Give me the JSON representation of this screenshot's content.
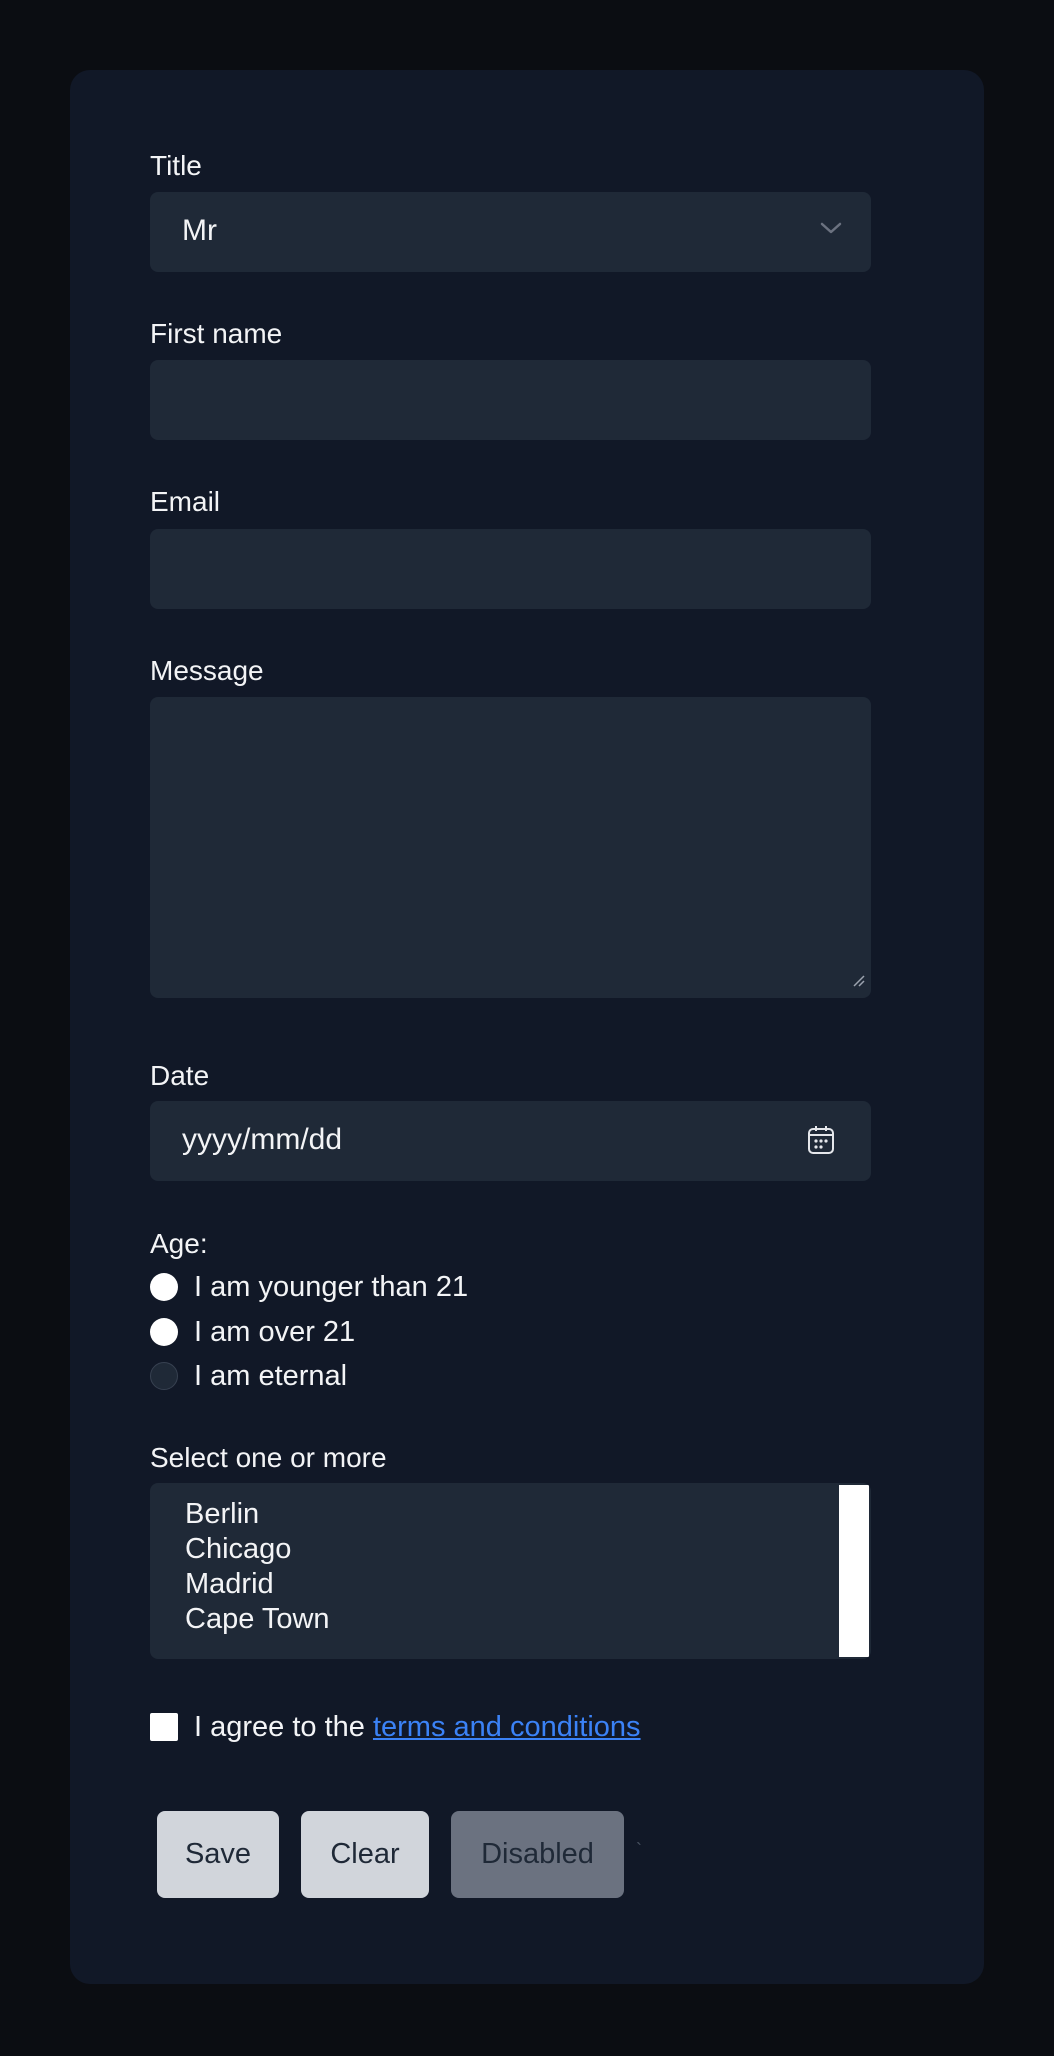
{
  "form": {
    "title_label": "Title",
    "title_value": "Mr",
    "first_name_label": "First name",
    "first_name_value": "",
    "email_label": "Email",
    "email_value": "",
    "message_label": "Message",
    "message_value": "",
    "date_label": "Date",
    "date_placeholder": "yyyy/mm/dd",
    "age_label": "Age:",
    "age_options": [
      {
        "label": "I am younger than 21",
        "checked": false
      },
      {
        "label": "I am over 21",
        "checked": false
      },
      {
        "label": "I am eternal",
        "checked": false,
        "disabled": true
      }
    ],
    "city_label": "Select one or more",
    "city_options": [
      "Berlin",
      "Chicago",
      "Madrid",
      "Cape Town"
    ],
    "agree_text": "I agree to the ",
    "terms_link": "terms and conditions",
    "agree_checked": false
  },
  "buttons": {
    "save": "Save",
    "clear": "Clear",
    "disabled": "Disabled"
  },
  "misc": {
    "stray_mark": "`"
  },
  "colors": {
    "page_bg": "#0b0d12",
    "card_bg": "#111827",
    "field_bg": "#1f2937",
    "text": "#f3f4f6",
    "link": "#3b82f6",
    "button_bg": "#d1d5db",
    "button_disabled_bg": "#6b7280"
  },
  "icons": {
    "title_select": "chevron-down-icon",
    "date": "calendar-icon",
    "textarea": "resize-handle-icon"
  }
}
